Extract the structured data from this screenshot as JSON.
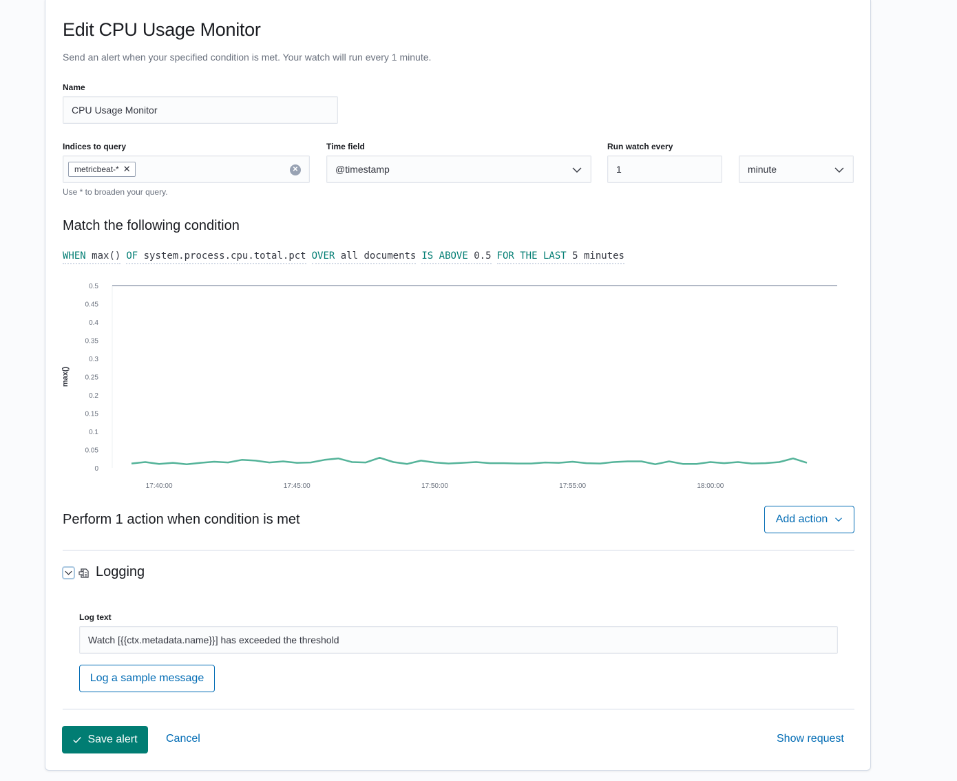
{
  "page": {
    "title": "Edit CPU Usage Monitor",
    "subtitle": "Send an alert when your specified condition is met. Your watch will run every 1 minute."
  },
  "name_field": {
    "label": "Name",
    "value": "CPU Usage Monitor"
  },
  "indices": {
    "label": "Indices to query",
    "chip": "metricbeat-*",
    "chip_remove": "✕",
    "clear": "✕",
    "help": "Use * to broaden your query."
  },
  "time_field": {
    "label": "Time field",
    "value": "@timestamp"
  },
  "run_every": {
    "label": "Run watch every",
    "value": "1",
    "unit": "minute"
  },
  "condition": {
    "heading": "Match the following condition",
    "when_kw": "WHEN",
    "when_val": "max()",
    "of_kw": "OF",
    "of_val": "system.process.cpu.total.pct",
    "over_kw": "OVER",
    "over_val": "all documents",
    "above_kw": "IS ABOVE",
    "above_val": "0.5",
    "last_kw": "FOR THE LAST",
    "last_val": "5 minutes"
  },
  "chart_data": {
    "type": "line",
    "ylabel": "max()",
    "xlabel": "",
    "ylim": [
      0,
      0.5
    ],
    "yticks": [
      "0.5",
      "0.45",
      "0.4",
      "0.35",
      "0.3",
      "0.25",
      "0.2",
      "0.15",
      "0.1",
      "0.05",
      "0"
    ],
    "xticks": [
      "17:40:00",
      "17:45:00",
      "17:50:00",
      "17:55:00",
      "18:00:00"
    ],
    "threshold": 0.5,
    "series": [
      {
        "color": "#54b399",
        "x_start": "17:39:00",
        "x_end": "18:04:00",
        "x_step_minutes": 0.5,
        "values": [
          0.012,
          0.016,
          0.011,
          0.014,
          0.01,
          0.014,
          0.017,
          0.015,
          0.022,
          0.02,
          0.015,
          0.018,
          0.014,
          0.015,
          0.022,
          0.026,
          0.016,
          0.015,
          0.028,
          0.016,
          0.011,
          0.02,
          0.015,
          0.012,
          0.014,
          0.016,
          0.013,
          0.013,
          0.012,
          0.012,
          0.015,
          0.014,
          0.017,
          0.013,
          0.012,
          0.016,
          0.018,
          0.018,
          0.01,
          0.018,
          0.011,
          0.011,
          0.016,
          0.013,
          0.016,
          0.012,
          0.013,
          0.016,
          0.026,
          0.014
        ]
      }
    ]
  },
  "actions": {
    "heading": "Perform 1 action when condition is met",
    "add_label": "Add action",
    "logging": {
      "title": "Logging",
      "log_text_label": "Log text",
      "log_text_value": "Watch [{{ctx.metadata.name}}] has exceeded the threshold",
      "sample_button": "Log a sample message"
    }
  },
  "footer": {
    "save": "Save alert",
    "cancel": "Cancel",
    "show_request": "Show request"
  }
}
